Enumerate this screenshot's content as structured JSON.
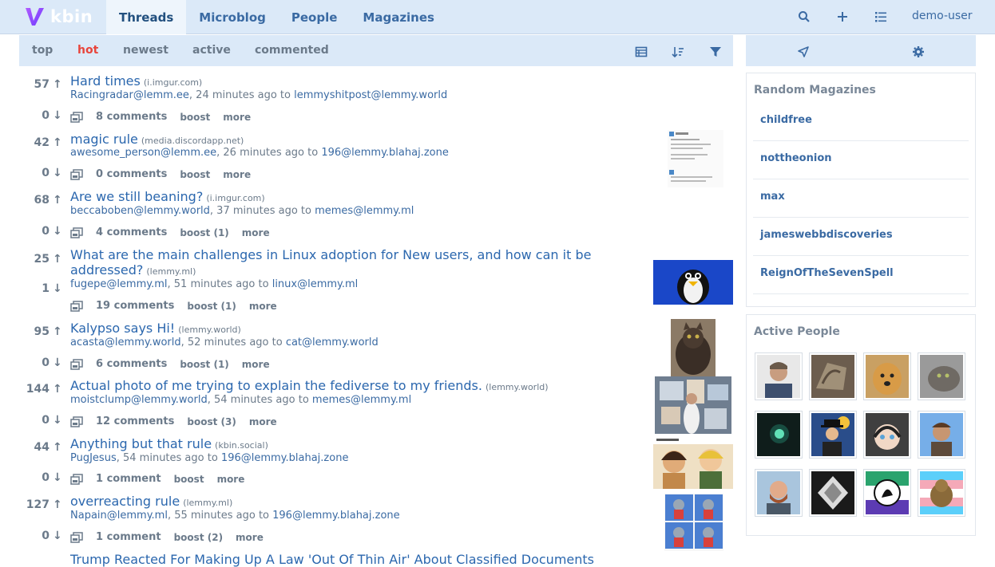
{
  "brand": {
    "name": "kbin"
  },
  "nav": {
    "tabs": [
      "Threads",
      "Microblog",
      "People",
      "Magazines"
    ],
    "active": "Threads",
    "user": "demo-user"
  },
  "sort": {
    "tabs": [
      "top",
      "hot",
      "newest",
      "active",
      "commented"
    ],
    "active": "hot"
  },
  "threads": [
    {
      "score": "57",
      "down": "0",
      "title": "Hard times",
      "domain": "(i.imgur.com)",
      "author": "Racingradar@lemm.ee",
      "time": ", 24 minutes ago to ",
      "magazine": "lemmyshitpost@lemmy.world",
      "comments": "8 comments",
      "boost": "boost",
      "more": "more"
    },
    {
      "score": "42",
      "down": "0",
      "title": "magic rule",
      "domain": "(media.discordapp.net)",
      "author": "awesome_person@lemm.ee",
      "time": ", 26 minutes ago to ",
      "magazine": "196@lemmy.blahaj.zone",
      "comments": "0 comments",
      "boost": "boost",
      "more": "more"
    },
    {
      "score": "68",
      "down": "0",
      "title": "Are we still beaning?",
      "domain": "(i.imgur.com)",
      "author": "beccaboben@lemmy.world",
      "time": ", 37 minutes ago to ",
      "magazine": "memes@lemmy.ml",
      "comments": "4 comments",
      "boost": "boost (1)",
      "more": "more"
    },
    {
      "score": "25",
      "down": "1",
      "title": "What are the main challenges in Linux adoption for New users, and how can it be addressed?",
      "domain": "(lemmy.ml)",
      "author": "fugepe@lemmy.ml",
      "time": ", 51 minutes ago to ",
      "magazine": "linux@lemmy.ml",
      "comments": "19 comments",
      "boost": "boost (1)",
      "more": "more"
    },
    {
      "score": "95",
      "down": "0",
      "title": "Kalypso says Hi!",
      "domain": "(lemmy.world)",
      "author": "acasta@lemmy.world",
      "time": ", 52 minutes ago to ",
      "magazine": "cat@lemmy.world",
      "comments": "6 comments",
      "boost": "boost (1)",
      "more": "more"
    },
    {
      "score": "144",
      "down": "0",
      "title": "Actual photo of me trying to explain the fediverse to my friends.",
      "domain": "(lemmy.world)",
      "author": "moistclump@lemmy.world",
      "time": ", 54 minutes ago to ",
      "magazine": "memes@lemmy.ml",
      "comments": "12 comments",
      "boost": "boost (3)",
      "more": "more"
    },
    {
      "score": "44",
      "down": "0",
      "title": "Anything but that rule",
      "domain": "(kbin.social)",
      "author": "PugJesus",
      "time": ", 54 minutes ago to ",
      "magazine": "196@lemmy.blahaj.zone",
      "comments": "1 comment",
      "boost": "boost",
      "more": "more"
    },
    {
      "score": "127",
      "down": "0",
      "title": "overreacting rule",
      "domain": "(lemmy.ml)",
      "author": "Napain@lemmy.ml",
      "time": ", 55 minutes ago to ",
      "magazine": "196@lemmy.blahaj.zone",
      "comments": "1 comment",
      "boost": "boost (2)",
      "more": "more"
    },
    {
      "score": "",
      "down": "",
      "title": "Trump Reacted For Making Up A Law 'Out Of Thin Air' About Classified Documents",
      "domain": "",
      "author": "",
      "time": "",
      "magazine": "",
      "comments": "",
      "boost": "",
      "more": ""
    }
  ],
  "random_magazines": {
    "title": "Random Magazines",
    "items": [
      "childfree",
      "nottheonion",
      "max",
      "jameswebbdiscoveries",
      "ReignOfTheSevenSpell"
    ]
  },
  "active_people": {
    "title": "Active People"
  }
}
